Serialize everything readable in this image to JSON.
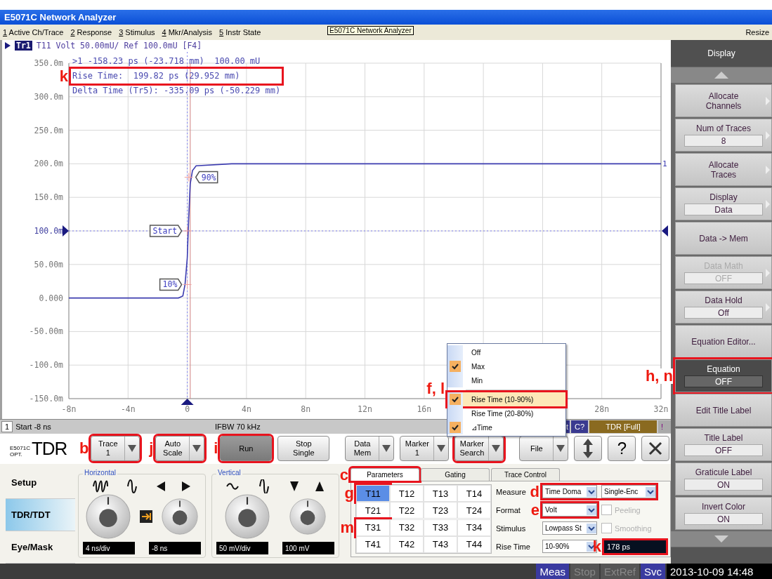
{
  "window": {
    "title": "E5071C Network Analyzer"
  },
  "menu_bar": {
    "items": [
      {
        "key": "1",
        "label": " Active Ch/Trace"
      },
      {
        "key": "2",
        "label": " Response"
      },
      {
        "key": "3",
        "label": " Stimulus"
      },
      {
        "key": "4",
        "label": " Mkr/Analysis"
      },
      {
        "key": "5",
        "label": " Instr State"
      }
    ],
    "tooltip": "E5071C Network Analyzer",
    "resize": "Resize"
  },
  "trace_header": {
    "badge": "Tr1",
    "text": "T11 Volt 50.00mU/ Ref 100.0mU [F4]"
  },
  "marker_readout": [
    {
      "text": ">1 -158.23 ps (-23.718 mm)  100.00 mU",
      "boxed": false
    },
    {
      "text": "Rise Time:  199.82 ps (29.952 mm)",
      "boxed": true,
      "callout": "k"
    },
    {
      "text": "Delta Time (Tr5): -335.09 ps (-50.229 mm)",
      "boxed": false
    }
  ],
  "chart_data": {
    "type": "line",
    "x": [
      -8,
      -0.6,
      -0.3,
      -0.15,
      0,
      0.1,
      0.2,
      0.35,
      0.6,
      3,
      32
    ],
    "series": [
      {
        "color": "#3c3cb0",
        "values": [
          0,
          0,
          3,
          20,
          60,
          120,
          170,
          190,
          197,
          200,
          200
        ]
      }
    ],
    "xlim": [
      -8,
      32
    ],
    "ylim": [
      -150,
      350
    ],
    "xticks": [
      {
        "value": -8,
        "label": "-8n"
      },
      {
        "value": -4,
        "label": "-4n"
      },
      {
        "value": 0,
        "label": "0"
      },
      {
        "value": 4,
        "label": "4n"
      },
      {
        "value": 8,
        "label": "8n"
      },
      {
        "value": 12,
        "label": "12n"
      },
      {
        "value": 16,
        "label": "16n"
      },
      {
        "value": 28,
        "label": "28n"
      },
      {
        "value": 32,
        "label": "32n"
      }
    ],
    "yticks": [
      {
        "value": 350,
        "label": "350.0m"
      },
      {
        "value": 300,
        "label": "300.0m"
      },
      {
        "value": 250,
        "label": "250.0m"
      },
      {
        "value": 200,
        "label": "200.0m"
      },
      {
        "value": 150,
        "label": "150.0m"
      },
      {
        "value": 100,
        "label": "100.0m"
      },
      {
        "value": 50,
        "label": "50.00m"
      },
      {
        "value": 0,
        "label": "0.000"
      },
      {
        "value": -50,
        "label": "-50.00m"
      },
      {
        "value": -100,
        "label": "-100.0m"
      },
      {
        "value": -150,
        "label": "-150.0m"
      }
    ],
    "grid": true,
    "ref_lines": [
      {
        "axis": "x",
        "value": 0.2,
        "color": "#d08080"
      }
    ],
    "annotations": [
      {
        "x": 0,
        "y": 100,
        "text": "Start"
      },
      {
        "x": 0,
        "y": 20,
        "text": "10%"
      },
      {
        "x": 0.1,
        "y": 180,
        "text": "90%"
      },
      {
        "x": 32,
        "y": 200,
        "text": "1"
      }
    ]
  },
  "marker_popup": [
    {
      "kind": "item",
      "label": "Off",
      "checked": false,
      "selected": false,
      "boxed": false
    },
    {
      "kind": "item",
      "label": "Max",
      "checked": true,
      "selected": false,
      "boxed": false
    },
    {
      "kind": "item",
      "label": "Min",
      "checked": false,
      "selected": false,
      "boxed": false
    },
    {
      "kind": "separator"
    },
    {
      "kind": "item",
      "label": "Rise Time (10-90%)",
      "checked": true,
      "selected": true,
      "boxed": true,
      "callout": "f, l"
    },
    {
      "kind": "item",
      "label": "Rise Time (20-80%)",
      "checked": false,
      "selected": false,
      "boxed": false
    },
    {
      "kind": "item",
      "label": "⊿Time",
      "checked": true,
      "selected": false,
      "boxed": false
    }
  ],
  "channel_status": [
    {
      "text": "1",
      "kind": "index"
    },
    {
      "text": "Start -8 ns",
      "kind": "plain"
    },
    {
      "text": "IFBW 70 kHz",
      "kind": "center"
    },
    {
      "text": "t",
      "kind": "fragment"
    },
    {
      "text": "C?",
      "kind": "blue"
    },
    {
      "text": "TDR [Full]",
      "kind": "brown"
    },
    {
      "text": "!",
      "kind": "alert"
    }
  ],
  "toolbar": {
    "logo_model": "E5071C",
    "logo_opt": "OPT.",
    "logo_name": "TDR",
    "buttons": [
      {
        "kind": "split",
        "lines": [
          "Trace",
          "1"
        ],
        "pressed": false,
        "boxed": true,
        "callout": "b"
      },
      {
        "kind": "split",
        "lines": [
          "Auto",
          "Scale"
        ],
        "pressed": false,
        "boxed": true,
        "callout": "j"
      },
      {
        "kind": "plain",
        "lines": [
          "Run"
        ],
        "pressed": true,
        "boxed": true,
        "callout": "i"
      },
      {
        "kind": "plain",
        "lines": [
          "Stop",
          "Single"
        ],
        "pressed": false,
        "boxed": false
      },
      {
        "kind": "split",
        "lines": [
          "Data",
          "Mem"
        ],
        "pressed": false,
        "boxed": false
      },
      {
        "kind": "split",
        "lines": [
          "Marker",
          "1"
        ],
        "pressed": false,
        "boxed": false
      },
      {
        "kind": "split",
        "lines": [
          "Marker",
          "Search"
        ],
        "pressed": false,
        "boxed": true
      },
      {
        "kind": "split",
        "lines": [
          "File"
        ],
        "pressed": false,
        "boxed": false
      },
      {
        "kind": "updown",
        "pressed": false,
        "boxed": false
      },
      {
        "kind": "text-icon",
        "lines": [
          "?"
        ],
        "pressed": false,
        "boxed": false
      },
      {
        "kind": "close",
        "pressed": false,
        "boxed": false
      }
    ]
  },
  "side_nav": [
    {
      "label": "Setup",
      "selected": false
    },
    {
      "label": "TDR/TDT",
      "selected": true
    },
    {
      "label": "Eye/Mask",
      "selected": false
    }
  ],
  "controls": [
    {
      "title": "Horizontal",
      "kind": "horizontal",
      "link": true,
      "readouts": [
        "4 ns/div",
        "-8 ns"
      ]
    },
    {
      "title": "Vertical",
      "kind": "vertical",
      "link": false,
      "readouts": [
        "50 mV/div",
        "100 mV"
      ]
    }
  ],
  "param_tabs": [
    {
      "label": "Parameters",
      "selected": true,
      "boxed": true,
      "callout": "c"
    },
    {
      "label": "Gating",
      "selected": false,
      "boxed": false
    },
    {
      "label": "Trace Control",
      "selected": false,
      "boxed": false
    }
  ],
  "parameter_grid": [
    [
      {
        "label": "T11",
        "selected": true,
        "boxed": true,
        "callout": "g"
      },
      {
        "label": "T12",
        "selected": false,
        "boxed": false
      },
      {
        "label": "T13",
        "selected": false,
        "boxed": false
      },
      {
        "label": "T14",
        "selected": false,
        "boxed": false
      }
    ],
    [
      {
        "label": "T21",
        "selected": false,
        "boxed": false
      },
      {
        "label": "T22",
        "selected": false,
        "boxed": false
      },
      {
        "label": "T23",
        "selected": false,
        "boxed": false
      },
      {
        "label": "T24",
        "selected": false,
        "boxed": false
      }
    ],
    [
      {
        "label": "T31",
        "selected": false,
        "boxed": true,
        "callout": "m"
      },
      {
        "label": "T32",
        "selected": false,
        "boxed": false
      },
      {
        "label": "T33",
        "selected": false,
        "boxed": false
      },
      {
        "label": "T34",
        "selected": false,
        "boxed": false
      }
    ],
    [
      {
        "label": "T41",
        "selected": false,
        "boxed": false
      },
      {
        "label": "T42",
        "selected": false,
        "boxed": false
      },
      {
        "label": "T43",
        "selected": false,
        "boxed": false
      },
      {
        "label": "T44",
        "selected": false,
        "boxed": false
      }
    ]
  ],
  "settings": [
    {
      "label": "Measure",
      "kind": "dropdowns",
      "values": [
        "Time Doma",
        "Single-Enc"
      ],
      "boxed": true,
      "callout": "d"
    },
    {
      "label": "Format",
      "kind": "dropdown-check",
      "values": [
        "Volt"
      ],
      "boxed": true,
      "callout": "e",
      "check_label": "Peeling",
      "checked": false,
      "check_disabled": true
    },
    {
      "label": "Stimulus",
      "kind": "dropdown-check",
      "values": [
        "Lowpass St"
      ],
      "boxed": false,
      "check_label": "Smoothing",
      "checked": false,
      "check_disabled": true
    },
    {
      "label": "Rise Time",
      "kind": "dropdown-readout",
      "values": [
        "10-90%"
      ],
      "boxed": false,
      "readout": "178 ps",
      "readout_boxed": true,
      "readout_callout": "k"
    }
  ],
  "softkeys": {
    "title": "Display",
    "keys": [
      {
        "lines": [
          "Allocate",
          "Channels"
        ],
        "submenu": true,
        "disabled": false,
        "selected": false,
        "boxed": false
      },
      {
        "lines": [
          "Num of Traces"
        ],
        "value": "8",
        "submenu": true,
        "disabled": false,
        "selected": false,
        "boxed": false
      },
      {
        "lines": [
          "Allocate",
          "Traces"
        ],
        "submenu": true,
        "disabled": false,
        "selected": false,
        "boxed": false
      },
      {
        "lines": [
          "Display"
        ],
        "value": "Data",
        "submenu": true,
        "disabled": false,
        "selected": false,
        "boxed": false
      },
      {
        "lines": [
          "Data -> Mem"
        ],
        "submenu": false,
        "disabled": false,
        "selected": false,
        "boxed": false
      },
      {
        "lines": [
          "Data Math"
        ],
        "value": "OFF",
        "submenu": true,
        "disabled": true,
        "selected": false,
        "boxed": false
      },
      {
        "lines": [
          "Data Hold"
        ],
        "value": "Off",
        "submenu": true,
        "disabled": false,
        "selected": false,
        "boxed": false
      },
      {
        "lines": [
          "Equation Editor..."
        ],
        "submenu": false,
        "disabled": false,
        "selected": false,
        "boxed": false
      },
      {
        "lines": [
          "Equation"
        ],
        "value": "OFF",
        "submenu": false,
        "disabled": false,
        "selected": true,
        "boxed": true,
        "callout": "h, n"
      },
      {
        "lines": [
          "Edit Title Label"
        ],
        "submenu": false,
        "disabled": false,
        "selected": false,
        "boxed": false
      },
      {
        "lines": [
          "Title Label"
        ],
        "value": "OFF",
        "submenu": false,
        "disabled": false,
        "selected": false,
        "boxed": false
      },
      {
        "lines": [
          "Graticule Label"
        ],
        "value": "ON",
        "submenu": false,
        "disabled": false,
        "selected": false,
        "boxed": false
      },
      {
        "lines": [
          "Invert Color"
        ],
        "value": "ON",
        "submenu": false,
        "disabled": false,
        "selected": false,
        "boxed": false
      }
    ]
  },
  "status_bar": [
    {
      "text": "Meas",
      "kind": "active"
    },
    {
      "text": "Stop",
      "kind": "dim"
    },
    {
      "text": "ExtRef",
      "kind": "dim"
    },
    {
      "text": "Svc",
      "kind": "active"
    },
    {
      "text": "2013-10-09 14:48",
      "kind": "clock"
    }
  ]
}
